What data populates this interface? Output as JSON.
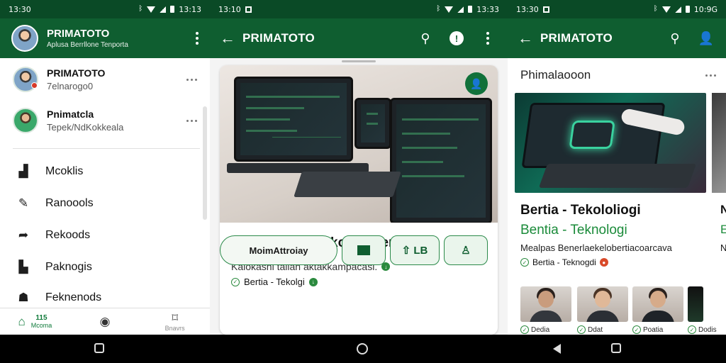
{
  "colors": {
    "primary": "#0f5e30",
    "status_bar": "#0a4a26",
    "accent_green": "#1b8b3a"
  },
  "screen1": {
    "status": {
      "time": "13:30",
      "right": "13:13"
    },
    "drawer_header": {
      "title": "PRIMATOTO",
      "subtitle": "Aplusa Berrllone Tenporta"
    },
    "accounts": [
      {
        "name": "PRIMATOTO",
        "sub": "7elnarogo0"
      },
      {
        "name": "Pnimatcla",
        "sub": "Tepek/NdKokkeala"
      }
    ],
    "nav_items": [
      {
        "label": "Mcoklis",
        "icon": "news-icon"
      },
      {
        "label": "Ranoools",
        "icon": "edit-icon"
      },
      {
        "label": "Rekoods",
        "icon": "share-icon"
      },
      {
        "label": "Paknogis",
        "icon": "bookmark-icon"
      },
      {
        "label": "Feknenods",
        "icon": "group-icon"
      }
    ],
    "bottom_nav": [
      {
        "count": "115",
        "label": "Mcoma",
        "icon": "home-icon"
      },
      {
        "label": "",
        "icon": "shield-icon"
      },
      {
        "label": "Bnavrs",
        "icon": "bookmark-icon"
      }
    ]
  },
  "screen2": {
    "status": {
      "time": "13:10",
      "right": "13:33"
    },
    "appbar_title": "PRIMATOTO",
    "card": {
      "title": "Dounia Itena Tekologi Tenenaya",
      "desc": "Kalokasni tallan aktakkampacasi.",
      "source": "Bertia - Tekolgi"
    },
    "buttons": {
      "main": "MoimAttroiay",
      "b3": "LB"
    }
  },
  "screen3": {
    "status": {
      "time": "13:30",
      "right": "10:9G"
    },
    "appbar_title": "PRIMATOTO",
    "section": "Phimalaooon",
    "article": {
      "title": "Bertia - Tekololiogi",
      "subtitle": "Bentia - Teknologi",
      "desc": "Mealpas Benerlaekelobertiacoarcava",
      "source": "Bertia - Teknogdi"
    },
    "edge_letters": [
      "N",
      "E",
      "N"
    ],
    "thumbs": [
      {
        "label": "Dedia"
      },
      {
        "label": "Ddat"
      },
      {
        "label": "Poatia"
      },
      {
        "label": "Dodis"
      }
    ]
  }
}
